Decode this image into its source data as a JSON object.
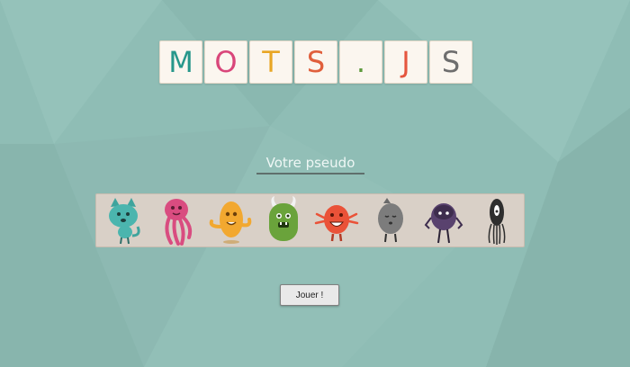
{
  "logo": {
    "letters": [
      {
        "char": "M",
        "color": "#27978b"
      },
      {
        "char": "O",
        "color": "#d9467a"
      },
      {
        "char": "T",
        "color": "#e8a624"
      },
      {
        "char": "S",
        "color": "#e05f3c"
      },
      {
        "char": ".",
        "color": "#5d9a3c"
      },
      {
        "char": "J",
        "color": "#e5563f"
      },
      {
        "char": "S",
        "color": "#6e6e6e"
      }
    ]
  },
  "pseudo_input": {
    "placeholder": "Votre pseudo",
    "value": ""
  },
  "avatars": [
    {
      "name": "teal-cat-monster-icon",
      "color": "#4bb5ae"
    },
    {
      "name": "pink-tentacle-monster-icon",
      "color": "#d94c80"
    },
    {
      "name": "orange-blob-monster-icon",
      "color": "#f2a830"
    },
    {
      "name": "green-horned-monster-icon",
      "color": "#6aa33b"
    },
    {
      "name": "red-spiky-monster-icon",
      "color": "#ea5238"
    },
    {
      "name": "gray-round-monster-icon",
      "color": "#7c7c7c"
    },
    {
      "name": "purple-beetle-monster-icon",
      "color": "#59426e"
    },
    {
      "name": "black-squid-monster-icon",
      "color": "#2e2e2e"
    }
  ],
  "play_button": {
    "label": "Jouer !"
  }
}
